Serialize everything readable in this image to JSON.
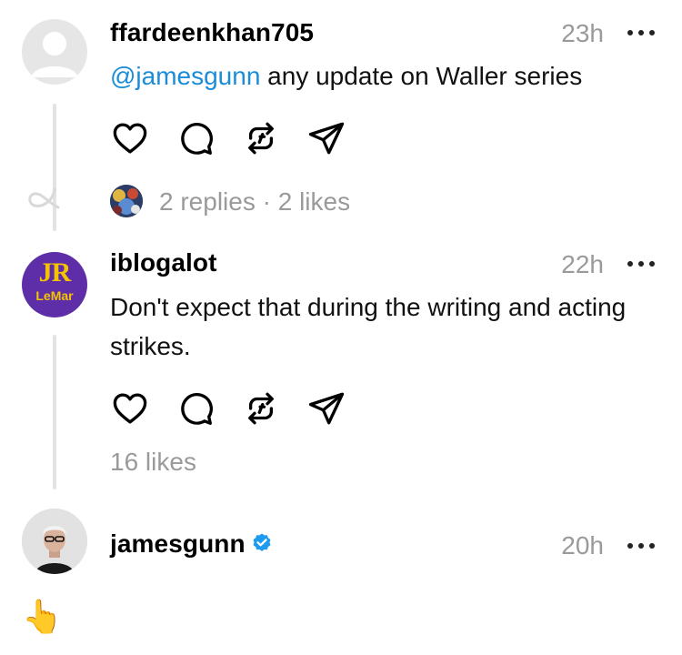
{
  "posts": [
    {
      "username": "ffardeenkhan705",
      "time": "23h",
      "mention": "@jamesgunn",
      "text": " any update on Waller series",
      "stats": "2 replies · 2 likes"
    },
    {
      "username": "iblogalot",
      "time": "22h",
      "text": "Don't expect that during the writing and acting strikes.",
      "avatar_text_top": "JR",
      "avatar_text_bottom": "LeMar",
      "stats": "16 likes"
    },
    {
      "username": "jamesgunn",
      "verified": true,
      "time": "20h",
      "text": "👆"
    }
  ],
  "colors": {
    "accent_link": "#1a8cd8",
    "verified": "#1d9bf0",
    "muted": "#9a9a9a",
    "avatar_purple": "#5e2ea8",
    "avatar_yellow": "#f5c400"
  },
  "icons": [
    "more-icon",
    "heart-icon",
    "comment-icon",
    "repost-icon",
    "share-icon",
    "verified-badge-icon"
  ]
}
